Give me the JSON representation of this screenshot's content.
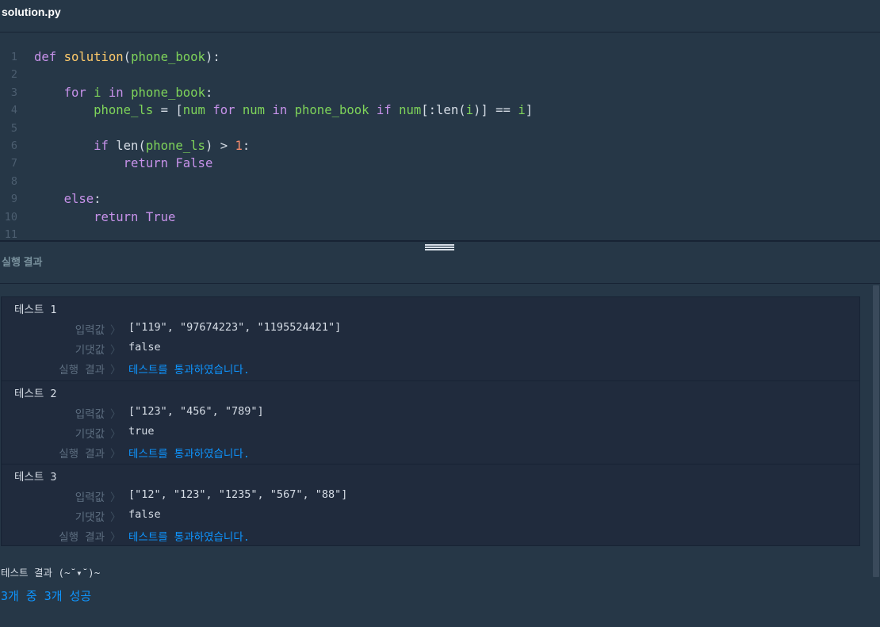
{
  "editor": {
    "filename": "solution.py",
    "lines": [
      {
        "n": "1",
        "tokens": [
          [
            "kw",
            "def "
          ],
          [
            "fn",
            "solution"
          ],
          [
            "pl",
            "("
          ],
          [
            "var",
            "phone_book"
          ],
          [
            "pl",
            "):"
          ]
        ]
      },
      {
        "n": "2",
        "tokens": []
      },
      {
        "n": "3",
        "tokens": [
          [
            "pl",
            "    "
          ],
          [
            "kw",
            "for "
          ],
          [
            "var",
            "i "
          ],
          [
            "kw",
            "in "
          ],
          [
            "var",
            "phone_book"
          ],
          [
            "pl",
            ":"
          ]
        ]
      },
      {
        "n": "4",
        "tokens": [
          [
            "pl",
            "        "
          ],
          [
            "var",
            "phone_ls"
          ],
          [
            "op",
            " = ["
          ],
          [
            "var",
            "num "
          ],
          [
            "kw",
            "for "
          ],
          [
            "var",
            "num "
          ],
          [
            "kw",
            "in "
          ],
          [
            "var",
            "phone_book "
          ],
          [
            "kw",
            "if "
          ],
          [
            "var",
            "num"
          ],
          [
            "pl",
            "[:len("
          ],
          [
            "var",
            "i"
          ],
          [
            "pl",
            ")] == "
          ],
          [
            "var",
            "i"
          ],
          [
            "pl",
            "]"
          ]
        ]
      },
      {
        "n": "5",
        "tokens": []
      },
      {
        "n": "6",
        "tokens": [
          [
            "pl",
            "        "
          ],
          [
            "kw",
            "if "
          ],
          [
            "pl",
            "len("
          ],
          [
            "var",
            "phone_ls"
          ],
          [
            "pl",
            ") > "
          ],
          [
            "num",
            "1"
          ],
          [
            "pl",
            ":"
          ]
        ]
      },
      {
        "n": "7",
        "tokens": [
          [
            "pl",
            "            "
          ],
          [
            "kw",
            "return "
          ],
          [
            "kw",
            "False"
          ]
        ]
      },
      {
        "n": "8",
        "tokens": []
      },
      {
        "n": "9",
        "tokens": [
          [
            "pl",
            "    "
          ],
          [
            "kw",
            "else"
          ],
          [
            "pl",
            ":"
          ]
        ]
      },
      {
        "n": "10",
        "tokens": [
          [
            "pl",
            "        "
          ],
          [
            "kw",
            "return "
          ],
          [
            "kw",
            "True"
          ]
        ]
      },
      {
        "n": "11",
        "tokens": []
      }
    ]
  },
  "results": {
    "title": "실행 결과",
    "labels": {
      "input": "입력값",
      "expected": "기댓값",
      "result": "실행 결과",
      "separator": "〉"
    },
    "tests": [
      {
        "name": "테스트 1",
        "input": "[\"119\", \"97674223\", \"1195524421\"]",
        "expected": "false",
        "result": "테스트를 통과하였습니다."
      },
      {
        "name": "테스트 2",
        "input": "[\"123\", \"456\", \"789\"]",
        "expected": "true",
        "result": "테스트를 통과하였습니다."
      },
      {
        "name": "테스트 3",
        "input": "[\"12\", \"123\", \"1235\", \"567\", \"88\"]",
        "expected": "false",
        "result": "테스트를 통과하였습니다."
      }
    ],
    "summary_label": "테스트 결과 (~˘▾˘)~",
    "summary_value": "3개 중 3개 성공"
  }
}
